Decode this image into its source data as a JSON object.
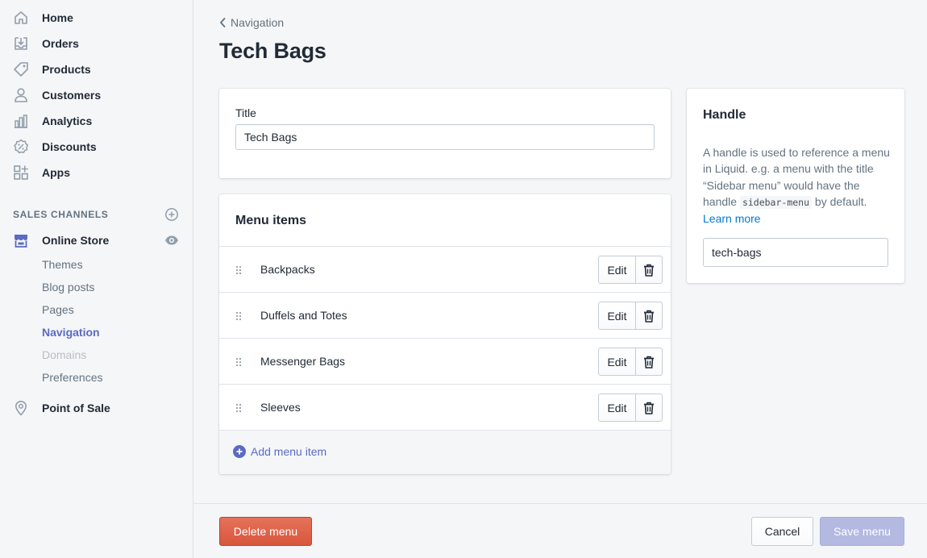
{
  "sidebar": {
    "items": [
      {
        "label": "Home",
        "icon": "home-icon"
      },
      {
        "label": "Orders",
        "icon": "orders-icon"
      },
      {
        "label": "Products",
        "icon": "tag-icon"
      },
      {
        "label": "Customers",
        "icon": "person-icon"
      },
      {
        "label": "Analytics",
        "icon": "bar-chart-icon"
      },
      {
        "label": "Discounts",
        "icon": "discount-icon"
      },
      {
        "label": "Apps",
        "icon": "apps-icon"
      }
    ],
    "sales_channels_title": "SALES CHANNELS",
    "online_store": {
      "label": "Online Store",
      "sub_items": [
        "Themes",
        "Blog posts",
        "Pages",
        "Navigation",
        "Domains",
        "Preferences"
      ],
      "active": "Navigation",
      "disabled": "Domains"
    },
    "point_of_sale": {
      "label": "Point of Sale"
    }
  },
  "header": {
    "breadcrumb": "Navigation",
    "title": "Tech Bags"
  },
  "title_card": {
    "label": "Title",
    "value": "Tech Bags"
  },
  "menu_card": {
    "heading": "Menu items",
    "items": [
      "Backpacks",
      "Duffels and Totes",
      "Messenger Bags",
      "Sleeves"
    ],
    "edit_label": "Edit",
    "add_label": "Add menu item"
  },
  "handle_card": {
    "heading": "Handle",
    "desc_1": "A handle is used to reference a menu in Liquid. e.g. a menu with the title “Sidebar menu” would have the handle ",
    "code": "sidebar-menu",
    "desc_2": " by default. ",
    "learn_more": "Learn more",
    "value": "tech-bags"
  },
  "footer": {
    "delete_label": "Delete menu",
    "cancel_label": "Cancel",
    "save_label": "Save menu"
  },
  "colors": {
    "accent": "#5c6ac4",
    "danger": "#de6247",
    "link": "#007ace",
    "save_disabled": "#b3b9e1"
  }
}
